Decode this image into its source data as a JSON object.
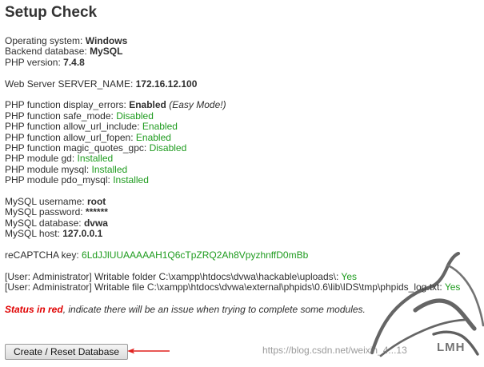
{
  "page_title": "Setup Check",
  "system": {
    "os_label": "Operating system: ",
    "os_value": "Windows",
    "db_label": "Backend database: ",
    "db_value": "MySQL",
    "php_label": "PHP version: ",
    "php_value": "7.4.8"
  },
  "server": {
    "label": "Web Server SERVER_NAME: ",
    "value": "172.16.12.100"
  },
  "php_functions": [
    {
      "label": "PHP function display_errors: ",
      "status": "Enabled",
      "note": "(Easy Mode!)"
    },
    {
      "label": "PHP function safe_mode: ",
      "status": "Disabled"
    },
    {
      "label": "PHP function allow_url_include: ",
      "status": "Enabled"
    },
    {
      "label": "PHP function allow_url_fopen: ",
      "status": "Enabled"
    },
    {
      "label": "PHP function magic_quotes_gpc: ",
      "status": "Disabled"
    },
    {
      "label": "PHP module gd: ",
      "status": "Installed"
    },
    {
      "label": "PHP module mysql: ",
      "status": "Installed"
    },
    {
      "label": "PHP module pdo_mysql: ",
      "status": "Installed"
    }
  ],
  "mysql": {
    "username_label": "MySQL username: ",
    "username_value": "root",
    "password_label": "MySQL password: ",
    "password_value": "******",
    "database_label": "MySQL database: ",
    "database_value": "dvwa",
    "host_label": "MySQL host: ",
    "host_value": "127.0.0.1"
  },
  "recaptcha": {
    "label": "reCAPTCHA key: ",
    "value": "6LdJJlUUAAAAAH1Q6cTpZRQ2Ah8VpyzhnffD0mBb"
  },
  "writable": {
    "folder_label": "[User: Administrator] Writable folder C:\\xampp\\htdocs\\dvwa\\hackable\\uploads\\: ",
    "folder_value": "Yes",
    "file_label": "[User: Administrator] Writable file C:\\xampp\\htdocs\\dvwa\\external\\phpids\\0.6\\lib\\IDS\\tmp\\phpids_log.txt: ",
    "file_value": "Yes"
  },
  "status_note": {
    "red_text": "Status in red",
    "rest_text": ", indicate there will be an issue when trying to complete some modules."
  },
  "button": {
    "label": "Create / Reset Database"
  },
  "watermark": {
    "url_text": "https://blog.csdn.net/weixin_4...13",
    "brand_text": "LMH"
  },
  "colors": {
    "ok": "#1e9b1e",
    "warn": "#e00000",
    "arrow": "#e0211f"
  },
  "icons": {
    "arrow": "red-left-arrow",
    "watermark_image": "horse-head-watermark"
  }
}
